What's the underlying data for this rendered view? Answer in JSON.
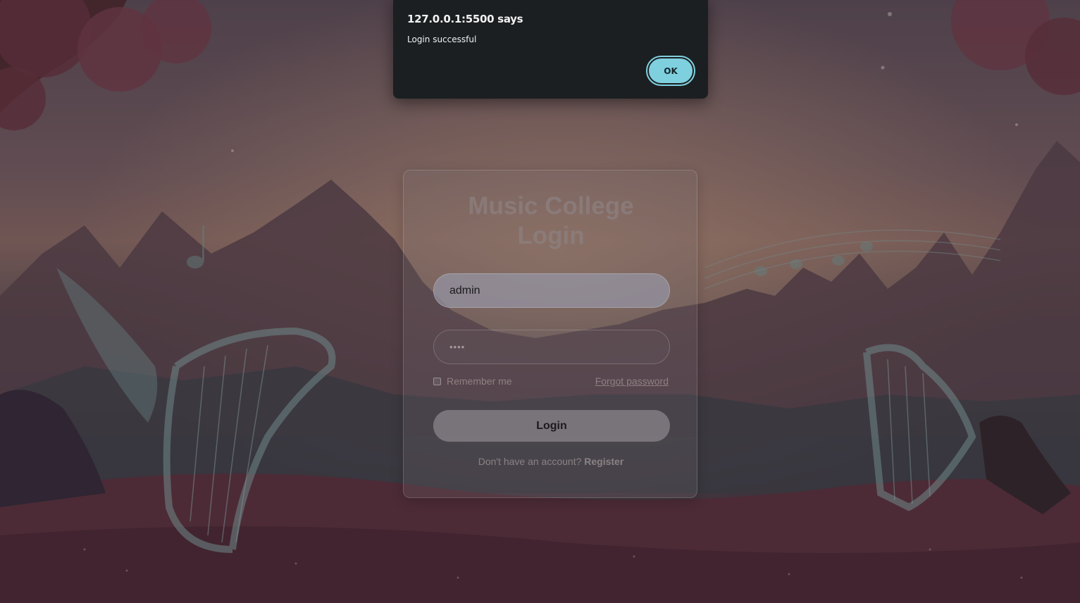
{
  "dialog": {
    "origin": "127.0.0.1:5500 says",
    "message": "Login successful",
    "ok_label": "OK"
  },
  "login": {
    "title_line1": "Music College",
    "title_line2": "Login",
    "username_value": "admin",
    "password_mask": "••••",
    "remember_label": "Remember me",
    "remember_checked": false,
    "forgot_label": "Forgot password",
    "submit_label": "Login",
    "register_prompt": "Don't have an account?",
    "register_label": "Register"
  },
  "colors": {
    "dialog_bg": "#1b1f22",
    "ok_button": "#7fd0df"
  },
  "icons": {
    "background": "fantasy-music-landscape-illustration"
  }
}
